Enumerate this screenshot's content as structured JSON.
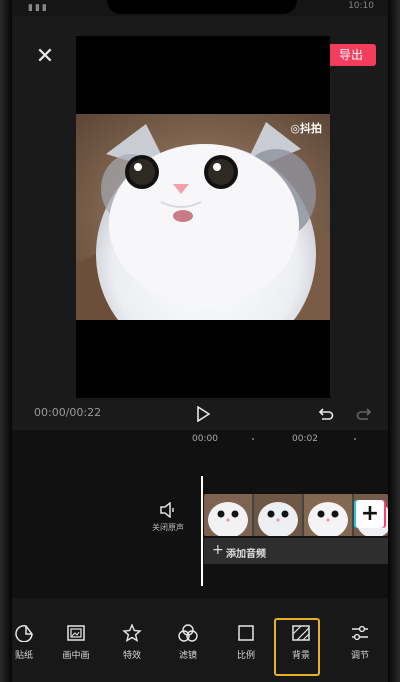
{
  "status": {
    "time": "10:10",
    "signal": "▮▮▮"
  },
  "topbar": {
    "close_icon": "close-icon",
    "fullscreen_icon": "fullscreen-icon",
    "export_label": "导出"
  },
  "preview": {
    "watermark": "◎抖拍"
  },
  "playback": {
    "timecode": "00:00/00:22"
  },
  "timeline": {
    "ruler": [
      "00:00",
      "00:02"
    ],
    "mute_label": "关闭原声",
    "add_clip_label": "+",
    "audio_plus": "+",
    "audio_label": "添加音频"
  },
  "toolbar": {
    "items": [
      {
        "label": "贴纸",
        "icon": "sticker-icon"
      },
      {
        "label": "画中画",
        "icon": "picture-in-picture-icon"
      },
      {
        "label": "特效",
        "icon": "effects-star-icon"
      },
      {
        "label": "滤镜",
        "icon": "filter-icon"
      },
      {
        "label": "比例",
        "icon": "ratio-icon"
      },
      {
        "label": "背景",
        "icon": "background-icon",
        "selected": true
      },
      {
        "label": "调节",
        "icon": "adjust-icon"
      }
    ]
  },
  "colors": {
    "accent": "#f23d5c",
    "highlight": "#e8b12a"
  }
}
